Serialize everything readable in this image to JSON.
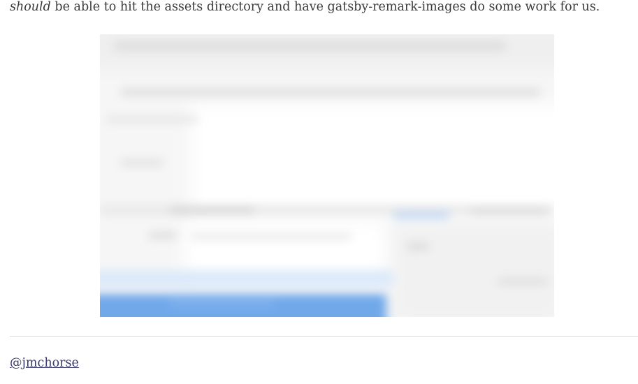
{
  "article": {
    "para_emphasis": "should",
    "para_rest": " be able to hit the assets directory and have gatsby-remark-images do some work for us."
  },
  "figure": {
    "blurred": true,
    "colors": {
      "background": "#f7f7f7",
      "panel": "#fdfdfd",
      "accent": "#6fa8ea"
    }
  },
  "footer": {
    "author_handle": "@jmchorse"
  }
}
